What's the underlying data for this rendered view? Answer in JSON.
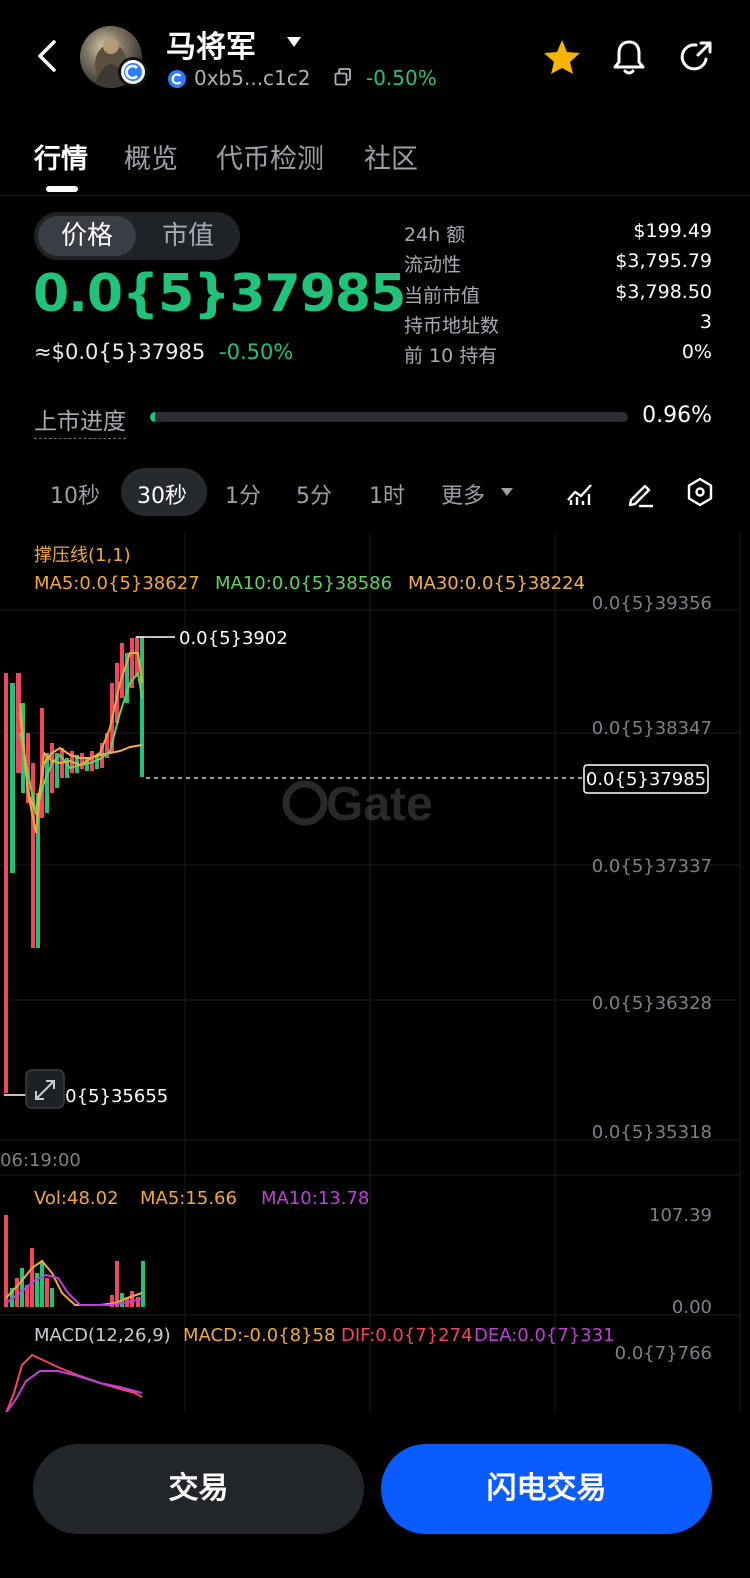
{
  "header": {
    "token_name": "马将军",
    "address": "0xb5...c1c2",
    "change": "-0.50%"
  },
  "tabs": [
    {
      "label": "行情",
      "active": true
    },
    {
      "label": "概览",
      "active": false
    },
    {
      "label": "代币检测",
      "active": false
    },
    {
      "label": "社区",
      "active": false
    }
  ],
  "price_toggle": {
    "price": "价格",
    "market_cap": "市值",
    "selected": "价格"
  },
  "price": {
    "value": "0.0{5}37985",
    "usd": "≈$0.0{5}37985",
    "change": "-0.50%"
  },
  "stats": [
    {
      "label": "24h  额",
      "value": "$199.49"
    },
    {
      "label": "流动性",
      "value": "$3,795.79"
    },
    {
      "label": "当前市值",
      "value": "$3,798.50"
    },
    {
      "label": "持币地址数",
      "value": "3"
    },
    {
      "label": "前 10 持有",
      "value": "0%"
    }
  ],
  "listing_progress": {
    "label": "上市进度",
    "value": "0.96%",
    "fraction": 0.0096
  },
  "intervals": [
    {
      "label": "10秒",
      "active": false
    },
    {
      "label": "30秒",
      "active": true
    },
    {
      "label": "1分",
      "active": false
    },
    {
      "label": "5分",
      "active": false
    },
    {
      "label": "1时",
      "active": false
    },
    {
      "label": "更多",
      "active": false
    }
  ],
  "chart": {
    "support_label": "撑压线(1,1)",
    "ma5": "MA5:0.0{5}38627",
    "ma10": "MA10:0.0{5}38586",
    "ma30": "MA30:0.0{5}38224",
    "high_label": "0.0{5}3902",
    "low_label": "0.0{5}35655",
    "current_label": "0.0{5}37985",
    "y_ticks": [
      "0.0{5}39356",
      "0.0{5}38347",
      "0.0{5}37337",
      "0.0{5}36328",
      "0.0{5}35318"
    ],
    "time_label": "06:19:00",
    "watermark": "Gate",
    "vol": "Vol:48.02",
    "vol_ma5": "MA5:15.66",
    "vol_ma10": "MA10:13.78",
    "vol_max": "107.39",
    "vol_min": "0.00",
    "macd_label": "MACD(12,26,9)",
    "macd_value": "MACD:-0.0{8}58",
    "dif": "DIF:0.0{7}274",
    "dea": "DEA:0.0{7}331",
    "macd_tick": "0.0{7}766"
  },
  "colors": {
    "up": "#21c37a",
    "down": "#f0475e",
    "ma5": "#f2a93b",
    "ma10": "#5fd35f",
    "ma30": "#f0b24a",
    "vol_ma10": "#c13fd8",
    "accent": "#0a5cff",
    "star": "#f5b400"
  },
  "buttons": {
    "trade": "交易",
    "flash_trade": "闪电交易"
  }
}
